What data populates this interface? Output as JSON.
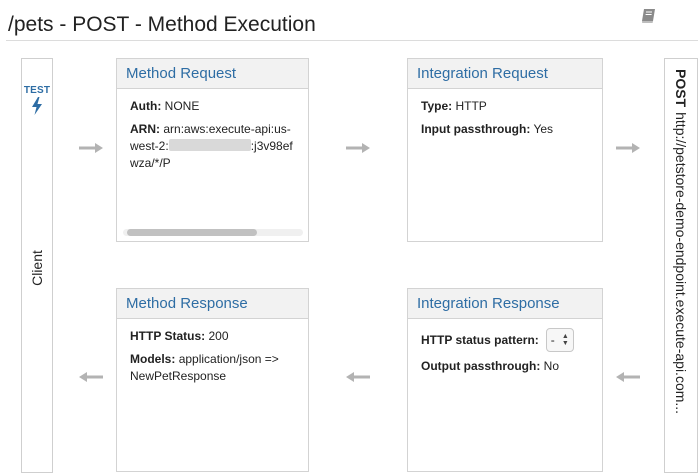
{
  "header": {
    "title": "/pets - POST - Method Execution",
    "book_icon": "book-icon"
  },
  "client": {
    "test_label": "TEST",
    "test_icon": "lightning-bolt-icon",
    "label": "Client"
  },
  "endpoint": {
    "method": "POST",
    "url": "http://petstore-demo-endpoint.execute-api.com..."
  },
  "method_request": {
    "title": "Method Request",
    "auth_label": "Auth:",
    "auth_value": "NONE",
    "arn_label": "ARN:",
    "arn_prefix": "arn:aws:execute-api:us-west-2:",
    "arn_suffix": ":j3v98efwza/*/P"
  },
  "integration_request": {
    "title": "Integration Request",
    "type_label": "Type:",
    "type_value": "HTTP",
    "passthrough_label": "Input passthrough:",
    "passthrough_value": "Yes"
  },
  "method_response": {
    "title": "Method Response",
    "status_label": "HTTP Status:",
    "status_value": "200",
    "models_label": "Models:",
    "models_value": "application/json => NewPetResponse"
  },
  "integration_response": {
    "title": "Integration Response",
    "pattern_label": "HTTP status pattern:",
    "pattern_value": "-",
    "output_label": "Output passthrough:",
    "output_value": "No"
  },
  "colors": {
    "link": "#2e6da4",
    "arrow": "#b3b3b3",
    "panel_header": "#f2f2f2",
    "border": "#d3d3d3"
  }
}
